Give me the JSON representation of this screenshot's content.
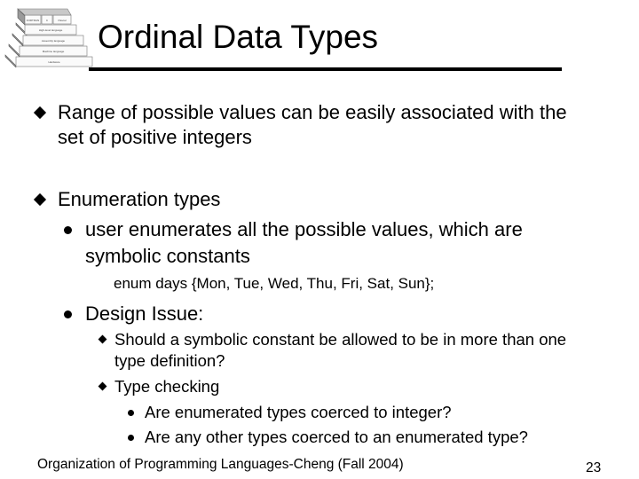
{
  "slide": {
    "title": "Ordinal Data Types",
    "logo": {
      "icon": "language-layers-pyramid-icon",
      "layers": [
        "FORTRAN",
        "C",
        "Pascal",
        "High-level language",
        "Assembly language",
        "Machine language",
        "Hardware"
      ]
    },
    "bullets": [
      {
        "level": 1,
        "lines": [
          "Range of possible values can be easily associated with the",
          "set of positive integers"
        ]
      },
      {
        "level": 1,
        "lines": [
          "Enumeration types"
        ]
      },
      {
        "level": 2,
        "lines": [
          "user enumerates all the possible values, which are",
          "symbolic constants"
        ]
      },
      {
        "level": "code",
        "lines": [
          "enum days {Mon, Tue, Wed, Thu, Fri, Sat, Sun};"
        ]
      },
      {
        "level": 2,
        "lines": [
          "Design Issue:"
        ]
      },
      {
        "level": 3,
        "lines": [
          "Should a symbolic constant be allowed to be in more than one",
          "type definition?"
        ]
      },
      {
        "level": 3,
        "lines": [
          "Type checking"
        ]
      },
      {
        "level": 4,
        "lines": [
          "Are enumerated types coerced to integer?"
        ]
      },
      {
        "level": 4,
        "lines": [
          "Are any other types coerced to an enumerated type?"
        ]
      }
    ],
    "footer": "Organization of Programming Languages-Cheng (Fall 2004)",
    "page_number": "23"
  }
}
